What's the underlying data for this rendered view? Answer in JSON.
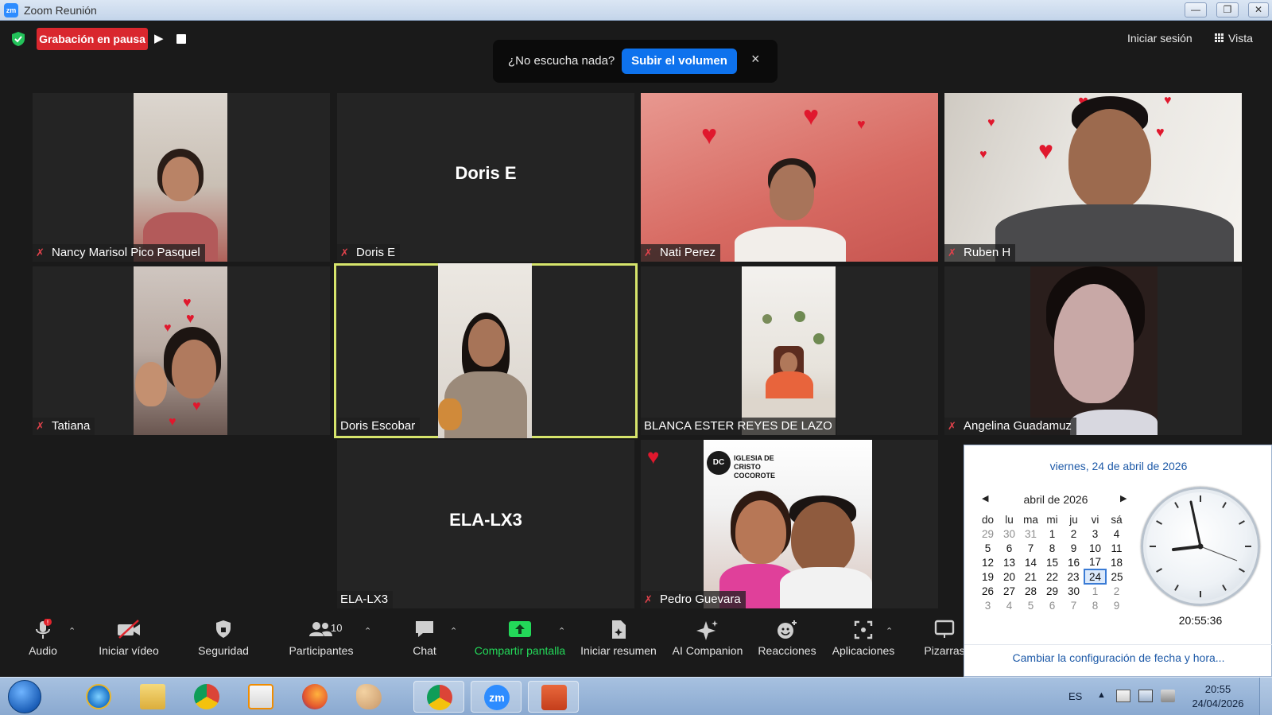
{
  "window": {
    "title": "Zoom Reunión",
    "app_icon": "zm"
  },
  "recording": {
    "status": "Grabación en pausa"
  },
  "topbar": {
    "signin": "Iniciar sesión",
    "view": "Vista"
  },
  "notice": {
    "message": "¿No escucha nada?",
    "button": "Subir el volumen",
    "close": "×"
  },
  "tiles": [
    {
      "name": "Nancy Marisol Pico Pasquel",
      "muted": true
    },
    {
      "name": "Doris E",
      "display_name": "Doris E",
      "muted": true
    },
    {
      "name": "Nati Perez",
      "muted": true
    },
    {
      "name": "Ruben H",
      "muted": true
    },
    {
      "name": "Tatiana",
      "muted": true
    },
    {
      "name": "Doris Escobar",
      "muted": false,
      "active_speaker": true
    },
    {
      "name": "BLANCA ESTER REYES DE LAZO",
      "muted": false
    },
    {
      "name": "Angelina Guadamuz",
      "muted": true
    },
    {
      "name": "ELA-LX3",
      "display_name": "ELA-LX3",
      "muted": false
    },
    {
      "name": "Pedro Guevara",
      "muted": true,
      "background_text": "IGLESIA DE CRISTO COCOROTE",
      "logo_text": "DC"
    }
  ],
  "toolbar": {
    "audio": "Audio",
    "video": "Iniciar vídeo",
    "security": "Seguridad",
    "participants": "Participantes",
    "participants_count": "10",
    "chat": "Chat",
    "share": "Compartir pantalla",
    "summary": "Iniciar resumen",
    "ai": "AI Companion",
    "reactions": "Reacciones",
    "apps": "Aplicaciones",
    "whiteboard": "Pizarras"
  },
  "calendar": {
    "date_title": "viernes, 24 de abril de 2026",
    "month_label": "abril de 2026",
    "weekdays": [
      "do",
      "lu",
      "ma",
      "mi",
      "ju",
      "vi",
      "sá"
    ],
    "weeks": [
      [
        "29",
        "30",
        "31",
        "1",
        "2",
        "3",
        "4"
      ],
      [
        "5",
        "6",
        "7",
        "8",
        "9",
        "10",
        "11"
      ],
      [
        "12",
        "13",
        "14",
        "15",
        "16",
        "17",
        "18"
      ],
      [
        "19",
        "20",
        "21",
        "22",
        "23",
        "24",
        "25"
      ],
      [
        "26",
        "27",
        "28",
        "29",
        "30",
        "1",
        "2"
      ],
      [
        "3",
        "4",
        "5",
        "6",
        "7",
        "8",
        "9"
      ]
    ],
    "today": "24",
    "time": "20:55:36",
    "settings_link": "Cambiar la configuración de fecha y hora..."
  },
  "taskbar": {
    "language": "ES",
    "time": "20:55",
    "date": "24/04/2026",
    "zoom_label": "zm"
  }
}
